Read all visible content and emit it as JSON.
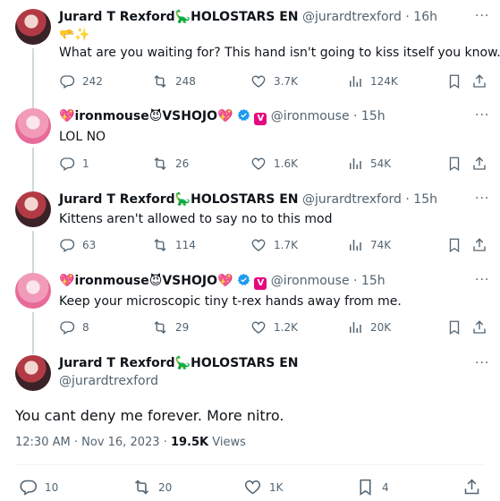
{
  "tweets": [
    {
      "name": "Jurard T Rexford",
      "name_suffix": "HOLOSTARS EN",
      "handle": "@jurardtrexford",
      "time": "16h",
      "emoji_line": "🫳✨",
      "text": "What are you waiting for? This hand isn't going to kiss itself you know.",
      "replies": "242",
      "reposts": "248",
      "likes": "3.7K",
      "views": "124K"
    },
    {
      "name_prefix": "💖",
      "name": "ironmouse",
      "name_mid": "😈",
      "name_tail": "VSHOJO",
      "name_end": "💖",
      "handle": "@ironmouse",
      "time": "15h",
      "text": "LOL NO",
      "replies": "1",
      "reposts": "26",
      "likes": "1.6K",
      "views": "54K"
    },
    {
      "name": "Jurard T Rexford",
      "name_suffix": "HOLOSTARS EN",
      "handle": "@jurardtrexford",
      "time": "15h",
      "text": "Kittens aren't allowed to say no to this mod",
      "replies": "63",
      "reposts": "114",
      "likes": "1.7K",
      "views": "74K"
    },
    {
      "name_prefix": "💖",
      "name": "ironmouse",
      "name_mid": "😈",
      "name_tail": "VSHOJO",
      "name_end": "💖",
      "handle": "@ironmouse",
      "time": "15h",
      "text": "Keep your microscopic tiny t-rex hands away from me.",
      "replies": "8",
      "reposts": "29",
      "likes": "1.2K",
      "views": "20K"
    }
  ],
  "main": {
    "name": "Jurard T Rexford",
    "name_suffix": "HOLOSTARS EN",
    "handle": "@jurardtrexford",
    "text": "You cant deny me forever. More nitro.",
    "time": "12:30 AM",
    "date": "Nov 16, 2023",
    "views_count": "19.5K",
    "views_label": "Views",
    "replies": "10",
    "reposts": "20",
    "likes": "1K",
    "bookmarks": "4"
  },
  "common": {
    "dot": "·",
    "menu": "···",
    "dino": "🦕"
  },
  "icons": [
    "reply-icon",
    "repost-icon",
    "like-icon",
    "views-icon",
    "bookmark-icon",
    "share-icon",
    "more-icon",
    "verified-icon"
  ],
  "colors": {
    "text": "#0f1419",
    "secondary": "#536471",
    "verified": "#1d9bf0",
    "vbadge": "#e5097f",
    "line": "#cfd9de"
  }
}
